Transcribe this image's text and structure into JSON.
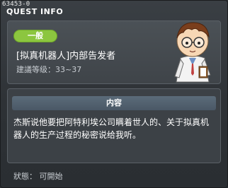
{
  "window": {
    "quest_id": "63453-0",
    "title": "QUEST INFO"
  },
  "summary": {
    "level_badge": "一般",
    "quest_name": "[拟真机器人]内部告发者",
    "requirement": "建議等级：33~37",
    "npc_icon": "scientist-npc-icon"
  },
  "description": {
    "header": "内容",
    "text": "杰斯说他要把阿特利埃公司瞒着世人的、关于拟真机器人的生产过程的秘密说给我听。"
  },
  "status": {
    "text": "狀態： 可開始"
  },
  "colors": {
    "badge": "#8cc63f",
    "header": "#556573",
    "background": "#2d3135"
  }
}
